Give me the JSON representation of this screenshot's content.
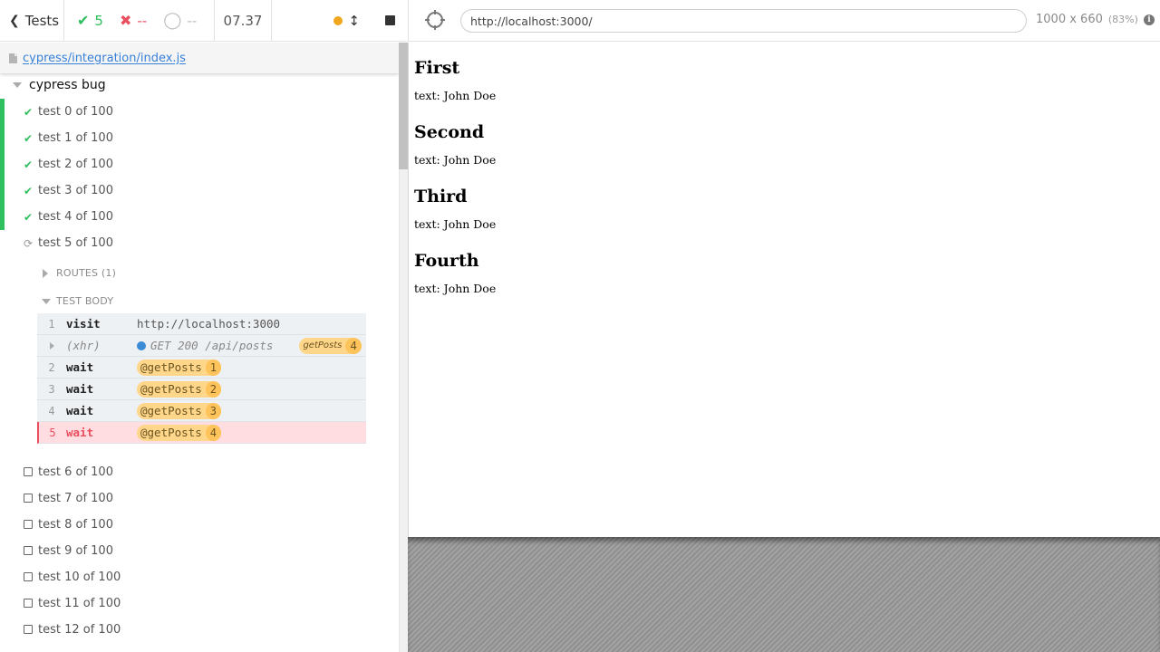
{
  "header": {
    "back_label": "Tests",
    "passed": "5",
    "failed": "--",
    "pending": "--",
    "duration": "07.37"
  },
  "spec": {
    "path": "cypress/integration/index.js"
  },
  "suite": {
    "title": "cypress bug"
  },
  "tests": [
    {
      "title": "test 0 of 100",
      "state": "passed"
    },
    {
      "title": "test 1 of 100",
      "state": "passed"
    },
    {
      "title": "test 2 of 100",
      "state": "passed"
    },
    {
      "title": "test 3 of 100",
      "state": "passed"
    },
    {
      "title": "test 4 of 100",
      "state": "passed"
    },
    {
      "title": "test 5 of 100",
      "state": "running"
    },
    {
      "title": "test 6 of 100",
      "state": "pending"
    },
    {
      "title": "test 7 of 100",
      "state": "pending"
    },
    {
      "title": "test 8 of 100",
      "state": "pending"
    },
    {
      "title": "test 9 of 100",
      "state": "pending"
    },
    {
      "title": "test 10 of 100",
      "state": "pending"
    },
    {
      "title": "test 11 of 100",
      "state": "pending"
    },
    {
      "title": "test 12 of 100",
      "state": "pending"
    }
  ],
  "routes_label": "ROUTES (1)",
  "test_body_label": "TEST BODY",
  "commands": [
    {
      "num": "1",
      "name": "visit",
      "message": "http://localhost:3000"
    },
    {
      "num": "",
      "name": "(xhr)",
      "message": "GET 200 /api/posts",
      "alias": "getPosts",
      "alias_count": "4"
    },
    {
      "num": "2",
      "name": "wait",
      "alias": "@getPosts",
      "alias_count": "1"
    },
    {
      "num": "3",
      "name": "wait",
      "alias": "@getPosts",
      "alias_count": "2"
    },
    {
      "num": "4",
      "name": "wait",
      "alias": "@getPosts",
      "alias_count": "3"
    },
    {
      "num": "5",
      "name": "wait",
      "alias": "@getPosts",
      "alias_count": "4"
    }
  ],
  "aut": {
    "url": "http://localhost:3000/",
    "viewport": "1000 x 660",
    "scale": "(83%)",
    "posts": [
      {
        "title": "First",
        "text": "text: John Doe"
      },
      {
        "title": "Second",
        "text": "text: John Doe"
      },
      {
        "title": "Third",
        "text": "text: John Doe"
      },
      {
        "title": "Fourth",
        "text": "text: John Doe"
      }
    ]
  },
  "colors": {
    "passed": "#2ebf5e",
    "failed": "#e94f5f",
    "link": "#3780d8",
    "running_dot": "#f0a71d",
    "alias_bg": "#ffd68a"
  },
  "icons": {
    "back": "chevron-left-icon",
    "passed": "check-icon",
    "failed": "x-icon",
    "pending": "circle-notch-icon",
    "stop": "stop-icon",
    "resize": "arrows-v-icon",
    "selector": "crosshairs-icon",
    "info": "info-circle-icon"
  }
}
